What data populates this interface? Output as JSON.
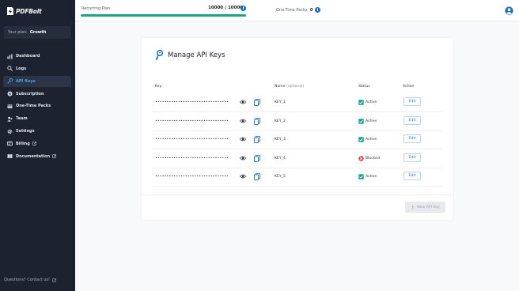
{
  "app": {
    "logo_text": "PDFBolt",
    "plan_label": "Your plan:",
    "plan_name": "Growth"
  },
  "sidebar": {
    "items": [
      {
        "label": "Dashboard",
        "icon": "chart-bars-icon",
        "external": false,
        "active": false
      },
      {
        "label": "Logs",
        "icon": "search-icon",
        "external": false,
        "active": false
      },
      {
        "label": "API Keys",
        "icon": "key-icon",
        "external": false,
        "active": true
      },
      {
        "label": "Subscription",
        "icon": "dollar-circle-icon",
        "external": false,
        "active": false
      },
      {
        "label": "One-Time Packs",
        "icon": "card-icon",
        "external": false,
        "active": false
      },
      {
        "label": "Team",
        "icon": "team-icon",
        "external": false,
        "active": false
      },
      {
        "label": "Settings",
        "icon": "gear-icon",
        "external": false,
        "active": false
      },
      {
        "label": "Billing",
        "icon": "receipt-icon",
        "external": true,
        "active": false
      },
      {
        "label": "Documentation",
        "icon": "book-icon",
        "external": true,
        "active": false
      }
    ],
    "footer": "Questions? Contact us!"
  },
  "topbar": {
    "recurring_label": "Recurring Plan",
    "recurring_count": "10000 / 10000",
    "recurring_progress": 1.0,
    "one_time_label": "One-Time Packs",
    "one_time_count": "0",
    "accent": "#1aa38c"
  },
  "main": {
    "title": "Manage API Keys",
    "columns": {
      "key": "Key",
      "name": "Name",
      "name_hint": "(optional)",
      "status": "Status",
      "action": "Action"
    },
    "rows": [
      {
        "key": "••••••••••••••••••••••••••••••••",
        "name": "KEY_1",
        "status": "Active",
        "action": "Edit"
      },
      {
        "key": "••••••••••••••••••••••••••••••••",
        "name": "KEY_2",
        "status": "Active",
        "action": "Edit"
      },
      {
        "key": "••••••••••••••••••••••••••••••••",
        "name": "KEY_3",
        "status": "Active",
        "action": "Edit"
      },
      {
        "key": "••••••••••••••••••••••••••••••••",
        "name": "KEY_4",
        "status": "Blocked",
        "action": "Edit"
      },
      {
        "key": "••••••••••••••••••••••••••••••••",
        "name": "KEY_5",
        "status": "Active",
        "action": "Edit"
      }
    ],
    "new_key_label": "New API Key",
    "colors": {
      "active": "#1aa38c",
      "blocked": "#d9453b",
      "link": "#2b74bd"
    }
  }
}
